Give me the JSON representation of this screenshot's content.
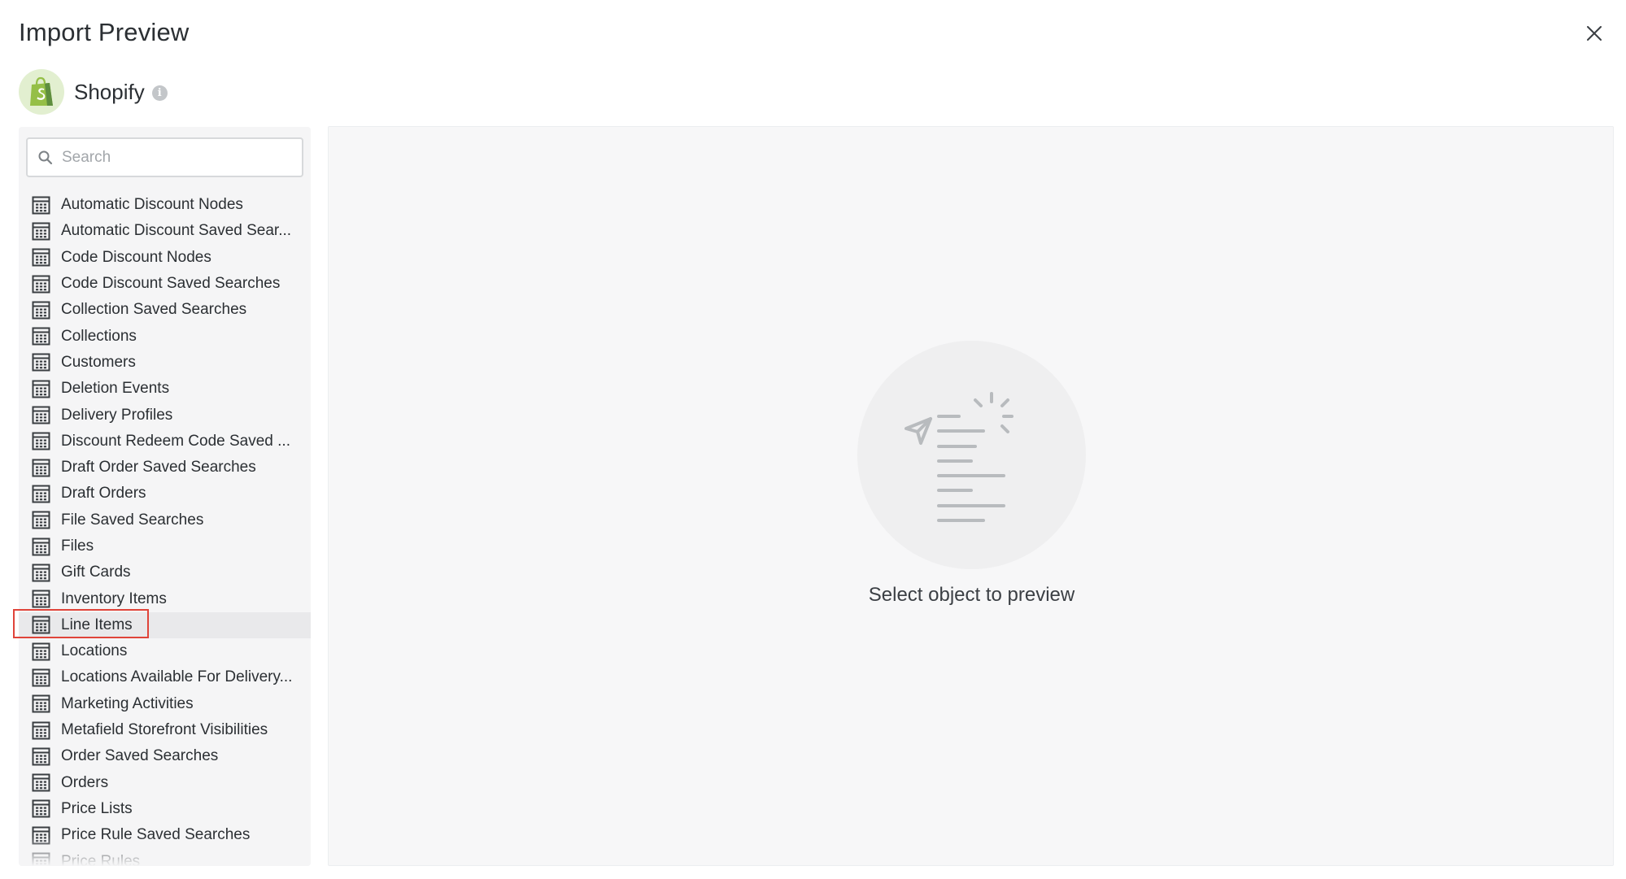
{
  "dialog": {
    "title": "Import Preview"
  },
  "connector": {
    "name": "Shopify",
    "logo_icon": "shopify-bag-icon",
    "info_icon": "info-icon",
    "info_glyph": "i"
  },
  "search": {
    "placeholder": "Search",
    "value": ""
  },
  "objects": [
    "Automatic Discount Nodes",
    "Automatic Discount Saved Sear...",
    "Code Discount Nodes",
    "Code Discount Saved Searches",
    "Collection Saved Searches",
    "Collections",
    "Customers",
    "Deletion Events",
    "Delivery Profiles",
    "Discount Redeem Code Saved ...",
    "Draft Order Saved Searches",
    "Draft Orders",
    "File Saved Searches",
    "Files",
    "Gift Cards",
    "Inventory Items",
    "Line Items",
    "Locations",
    "Locations Available For Delivery...",
    "Marketing Activities",
    "Metafield Storefront Visibilities",
    "Order Saved Searches",
    "Orders",
    "Price Lists",
    "Price Rule Saved Searches",
    "Price Rules"
  ],
  "selected_object": "Line Items",
  "preview": {
    "empty_message": "Select object to preview",
    "illustration_icon": "send-document-icon"
  },
  "colors": {
    "highlight": "#e0443a",
    "shopify_green": "#95bf47",
    "shopify_dark": "#5e8e3e"
  }
}
